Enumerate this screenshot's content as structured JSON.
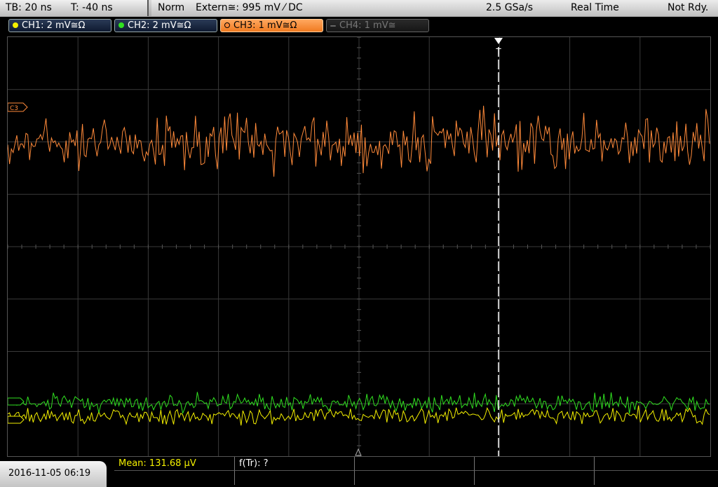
{
  "topbar": {
    "timebase": "TB: 20 ns",
    "trigger_time": "T: -40 ns",
    "mode": "Norm",
    "trigger_source": "Extern≅: 995 mV ⁄ DC",
    "sample_rate": "2.5 GSa/s",
    "acquisition": "Real Time",
    "status": "Not Rdy."
  },
  "channels": [
    {
      "label": "CH1: 2 mV≅Ω",
      "color": "#f4f000",
      "state": "on"
    },
    {
      "label": "CH2: 2 mV≅Ω",
      "color": "#30e020",
      "state": "on"
    },
    {
      "label": "CH3: 1 mV≅Ω",
      "color": "#ff8a3a",
      "state": "active"
    },
    {
      "label": "CH4: 1 mV≅",
      "color": "#888888",
      "state": "off"
    }
  ],
  "markers": {
    "ch3": "C3",
    "trigger": "T"
  },
  "measurements": {
    "mean": "Mean: 131.68 µV",
    "freq": "f(Tr): ?"
  },
  "datetime": "2016-11-05 06:19",
  "colors": {
    "ch1": "#f4f000",
    "ch2": "#30e020",
    "ch3": "#ff8a3a",
    "grid": "#3a3a3a"
  },
  "icons": [
    "trigger-position-icon",
    "ground-marker-icon"
  ]
}
